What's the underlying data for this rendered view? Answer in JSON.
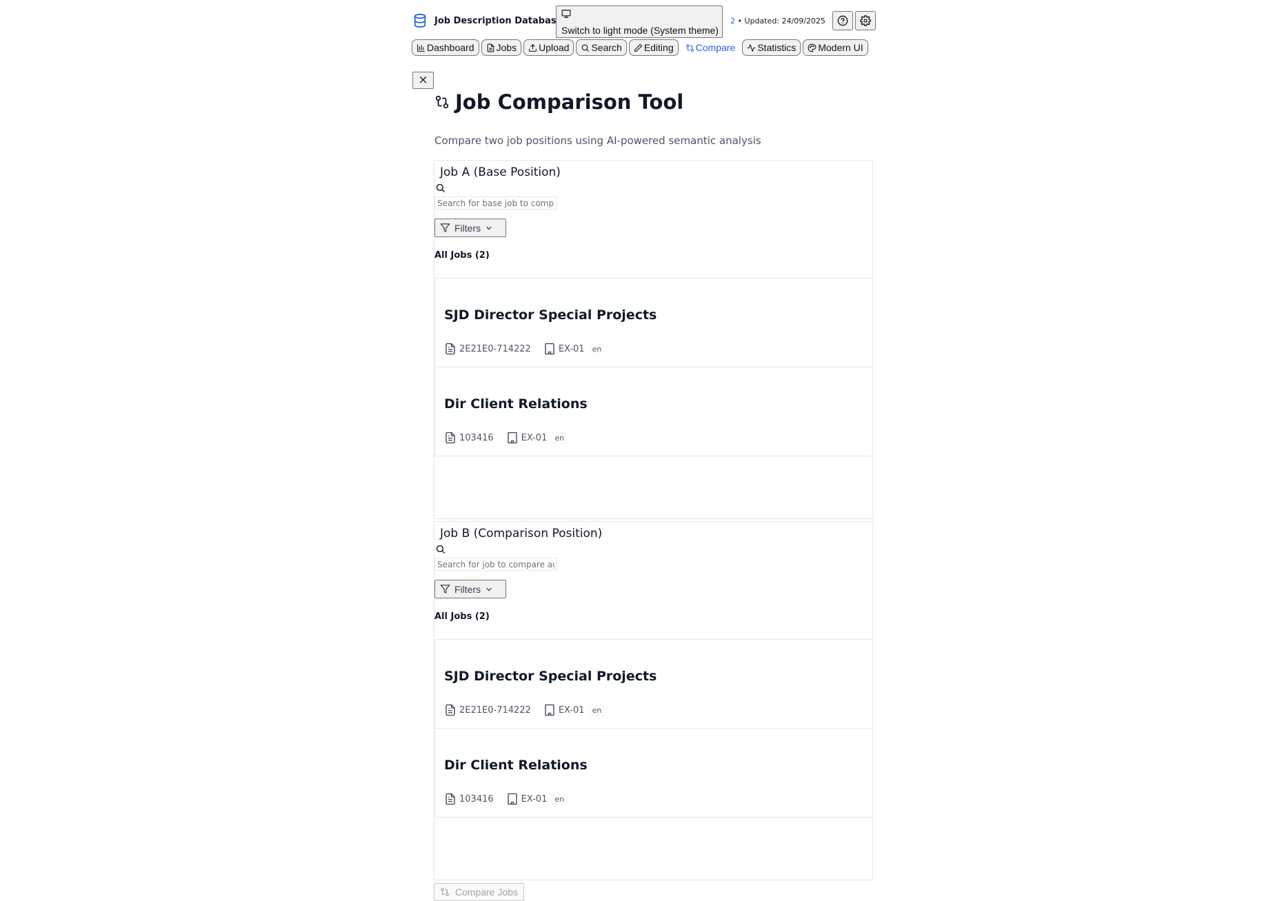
{
  "app": {
    "title": "Job Description Database",
    "theme_button": "Switch to light mode (System theme)",
    "job_count": "2",
    "updated": " • Updated: 24/09/2025"
  },
  "nav": [
    {
      "label": "Dashboard",
      "icon": "bar-chart-icon",
      "active": false
    },
    {
      "label": "Jobs",
      "icon": "file-icon",
      "active": false
    },
    {
      "label": "Upload",
      "icon": "upload-icon",
      "active": false
    },
    {
      "label": "Search",
      "icon": "search-icon",
      "active": false
    },
    {
      "label": "Editing",
      "icon": "pencil-icon",
      "active": true
    },
    {
      "label": "Compare",
      "icon": "compare-icon",
      "active": true
    },
    {
      "label": "Statistics",
      "icon": "activity-icon",
      "active": false
    },
    {
      "label": "Modern UI",
      "icon": "palette-icon",
      "active": false
    }
  ],
  "page": {
    "close": "×",
    "title": "Job Comparison Tool",
    "subtitle": "Compare two job positions using AI-powered semantic analysis"
  },
  "panel_a": {
    "title": "Job A (Base Position)",
    "placeholder": "Search for base job to compare",
    "filters": "Filters",
    "all_jobs": "All Jobs (2)",
    "jobs": [
      {
        "title": "SJD Director Special Projects",
        "id": "2E21E0-714222",
        "classification": "EX-01",
        "lang": "en"
      },
      {
        "title": "Dir Client Relations",
        "id": "103416",
        "classification": "EX-01",
        "lang": "en"
      }
    ]
  },
  "panel_b": {
    "title": "Job B (Comparison Position)",
    "placeholder": "Search for job to compare against",
    "filters": "Filters",
    "all_jobs": "All Jobs (2)",
    "jobs": [
      {
        "title": "SJD Director Special Projects",
        "id": "2E21E0-714222",
        "classification": "EX-01",
        "lang": "en"
      },
      {
        "title": "Dir Client Relations",
        "id": "103416",
        "classification": "EX-01",
        "lang": "en"
      }
    ]
  },
  "compare_button": "Compare Jobs",
  "colors": {
    "accent": "#2563eb",
    "border": "#e5e7eb",
    "muted": "#4b5563"
  }
}
